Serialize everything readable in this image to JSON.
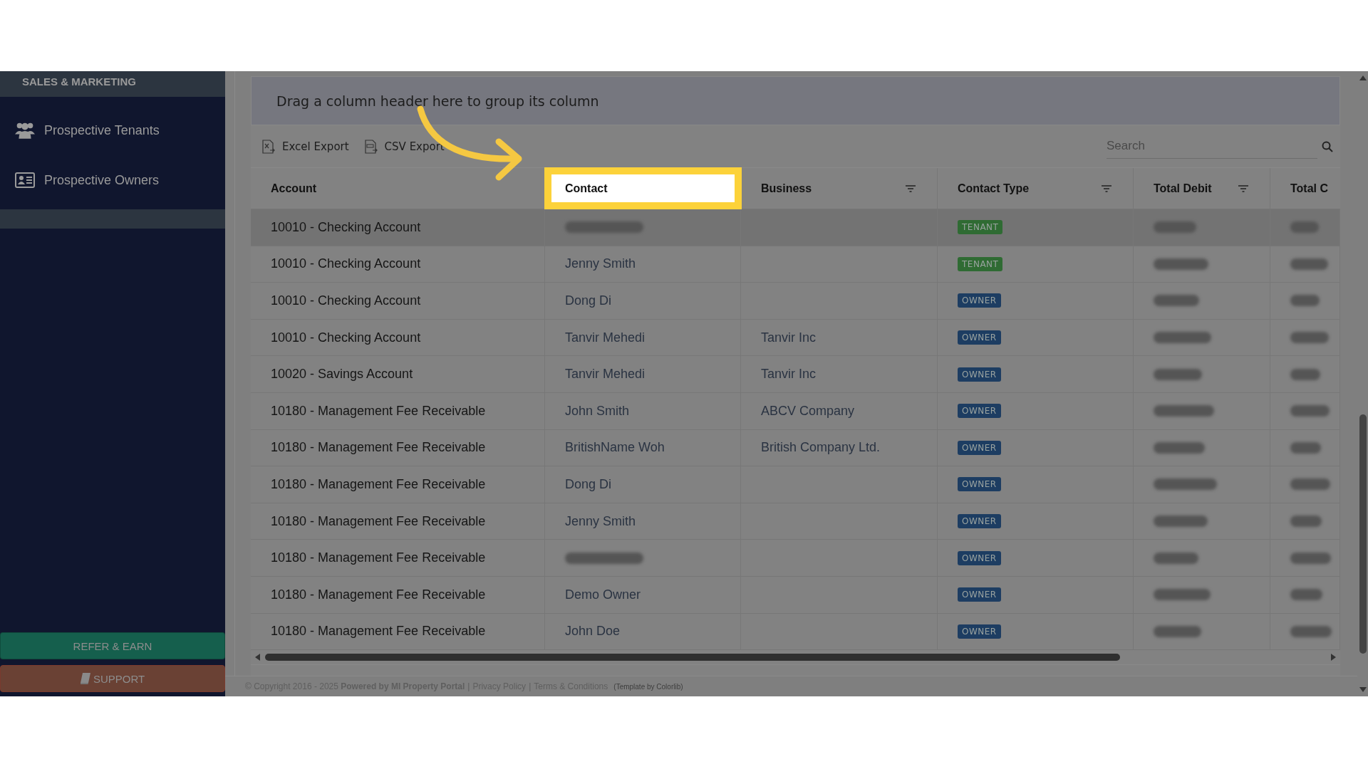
{
  "sidebar": {
    "section": "SALES & MARKETING",
    "items": [
      {
        "label": "Prospective Tenants",
        "kind": "people"
      },
      {
        "label": "Prospective Owners",
        "kind": "card"
      }
    ],
    "buttons": [
      {
        "label": "REFER & EARN",
        "kind": "refer"
      },
      {
        "label": "SUPPORT",
        "kind": "support"
      }
    ]
  },
  "grid": {
    "group_panel": "Drag a column header here to group its column",
    "toolbar": [
      {
        "label": "Excel Export",
        "kind": "excel"
      },
      {
        "label": "CSV Export",
        "kind": "csv"
      }
    ],
    "search": {
      "placeholder": "Search"
    },
    "columns": [
      {
        "label": "Account",
        "filter": false,
        "highlighted": false
      },
      {
        "label": "Contact",
        "filter": false,
        "highlighted": true
      },
      {
        "label": "Business",
        "filter": true,
        "highlighted": false
      },
      {
        "label": "Contact Type",
        "filter": true,
        "highlighted": false
      },
      {
        "label": "Total Debit",
        "filter": true,
        "highlighted": false
      },
      {
        "label": "Total C",
        "filter": false,
        "highlighted": false
      }
    ],
    "rows": [
      {
        "account": "10010 - Checking Account",
        "selected": true,
        "tag": {
          "label": "TENANT",
          "color": "#2f6b33"
        }
      },
      {
        "account": "10010 - Checking Account",
        "contact": "Jenny Smith",
        "selected": false,
        "tag": {
          "label": "TENANT",
          "color": "#2f6b33"
        }
      },
      {
        "account": "10010 - Checking Account",
        "contact": "Dong Di",
        "selected": false,
        "tag": {
          "label": "OWNER",
          "color": "#1d3d62"
        }
      },
      {
        "account": "10010 - Checking Account",
        "contact": "Tanvir Mehedi",
        "business": "Tanvir Inc",
        "selected": false,
        "tag": {
          "label": "OWNER",
          "color": "#1d3d62"
        }
      },
      {
        "account": "10020 - Savings Account",
        "contact": "Tanvir Mehedi",
        "business": "Tanvir Inc",
        "selected": false,
        "tag": {
          "label": "OWNER",
          "color": "#1d3d62"
        }
      },
      {
        "account": "10180 - Management Fee Receivable",
        "contact": "John Smith",
        "business": "ABCV Company",
        "selected": false,
        "tag": {
          "label": "OWNER",
          "color": "#1d3d62"
        }
      },
      {
        "account": "10180 - Management Fee Receivable",
        "contact": "BritishName Woh",
        "business": "British Company Ltd.",
        "selected": false,
        "tag": {
          "label": "OWNER",
          "color": "#1d3d62"
        }
      },
      {
        "account": "10180 - Management Fee Receivable",
        "contact": "Dong Di",
        "selected": false,
        "tag": {
          "label": "OWNER",
          "color": "#1d3d62"
        }
      },
      {
        "account": "10180 - Management Fee Receivable",
        "contact": "Jenny Smith",
        "selected": false,
        "tag": {
          "label": "OWNER",
          "color": "#1d3d62"
        }
      },
      {
        "account": "10180 - Management Fee Receivable",
        "selected": false,
        "tag": {
          "label": "OWNER",
          "color": "#1d3d62"
        }
      },
      {
        "account": "10180 - Management Fee Receivable",
        "contact": "Demo Owner",
        "selected": false,
        "tag": {
          "label": "OWNER",
          "color": "#1d3d62"
        }
      },
      {
        "account": "10180 - Management Fee Receivable",
        "contact": "John Doe",
        "selected": false,
        "tag": {
          "label": "OWNER",
          "color": "#1d3d62"
        }
      }
    ]
  },
  "footer": {
    "copyright": "© Copyright 2016 - 2025 **Powered by MI Property Portal**",
    "separator": "|",
    "links": [
      "Privacy Policy",
      "Terms & Conditions"
    ],
    "credit": "(Template by Colorlib)"
  }
}
